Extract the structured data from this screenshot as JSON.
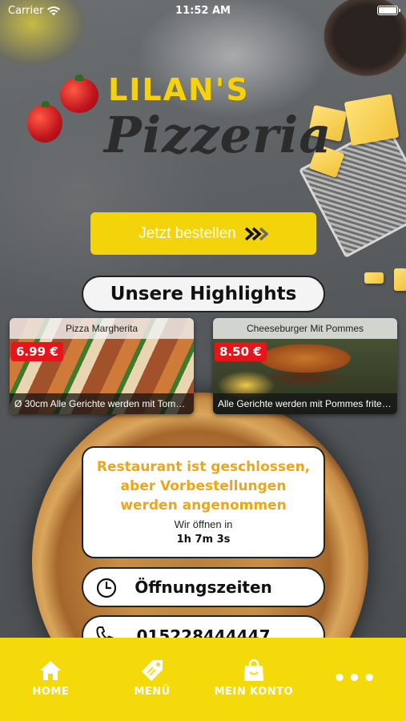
{
  "status_bar": {
    "carrier": "Carrier",
    "time": "11:52 AM",
    "icons": [
      "wifi-icon",
      "battery-icon"
    ]
  },
  "logo": {
    "line1": "LILAN'S",
    "line2": "Pizzeria"
  },
  "order_button": {
    "label": "Jetzt bestellen",
    "icon": "double-chevron-right-icon"
  },
  "highlights": {
    "title": "Unsere Highlights",
    "items": [
      {
        "name": "Pizza Margherita",
        "price": "6.99 €",
        "description": "Ø 30cm Alle Gerichte werden mit Tomat..."
      },
      {
        "name": "Cheeseburger Mit Pommes",
        "price": "8.50 €",
        "description": "Alle Gerichte werden mit Pommes frites..."
      }
    ]
  },
  "status_card": {
    "message": "Restaurant ist geschlossen, aber Vorbestellungen werden angenommen",
    "open_in_label": "Wir öffnen in",
    "countdown": "1h 7m 3s"
  },
  "hours_button": {
    "label": "Öffnungszeiten",
    "icon": "clock-icon"
  },
  "phone_button": {
    "label": "015228444447",
    "icon": "phone-icon"
  },
  "tab_bar": {
    "items": [
      {
        "label": "HOME",
        "icon": "home-icon"
      },
      {
        "label": "MENÜ",
        "icon": "tag-icon"
      },
      {
        "label": "MEIN KONTO",
        "icon": "shopping-bag-icon"
      },
      {
        "label": "•••",
        "icon": "more-icon"
      }
    ]
  },
  "colors": {
    "accent_yellow": "#f4d90b",
    "price_red": "#e6151c",
    "status_orange": "#f0a514"
  }
}
